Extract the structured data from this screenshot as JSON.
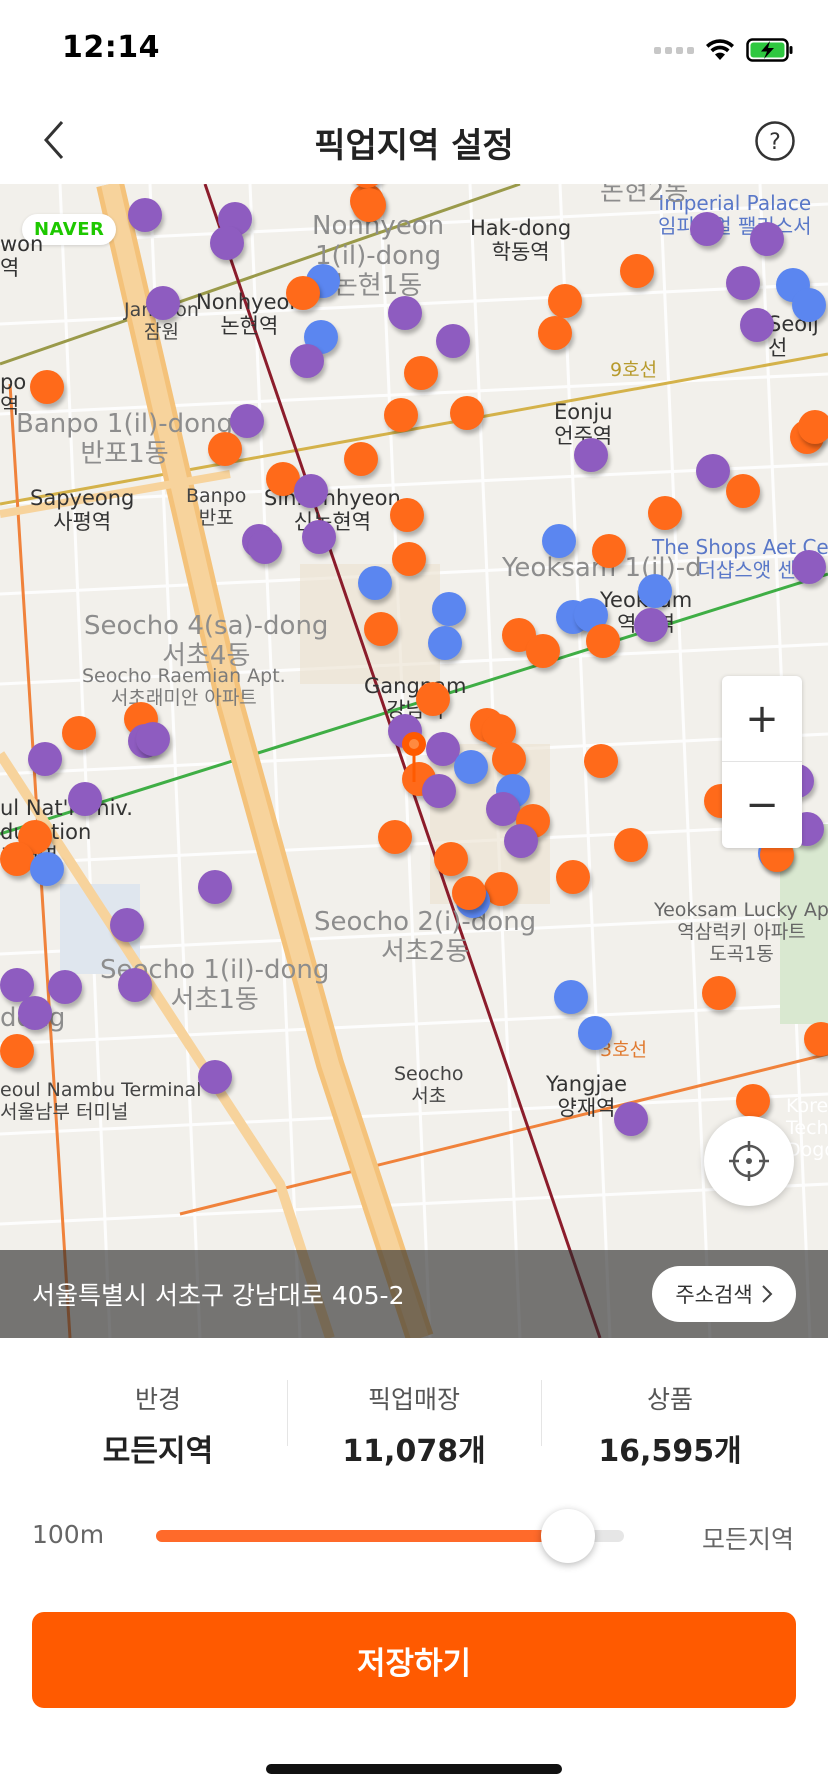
{
  "status_bar": {
    "time": "12:14"
  },
  "header": {
    "title": "픽업지역 설정"
  },
  "map": {
    "provider_logo": "NAVER",
    "labels": {
      "nonhyeon1": "Nonhyeon\n1(il)-dong\n논현1동",
      "hakdong": "Hak-dong\n학동역",
      "imperial": "Imperial Palace\n임피리얼 팰리스서",
      "jamwon": "Jamwon\n잠원",
      "nonhyeon_stn": "Nonhyeon\n논현역",
      "banpo1": "Banpo 1(il)-dong\n반포1동",
      "eonju": "Eonju\n언주역",
      "sapyeong": "Sapyeong\n사평역",
      "banpo_ic": "Banpo\n반포",
      "sinnonhyeon": "Sinnonhyeon\n신논현역",
      "shops": "The Shops Aet Cen\n더샵스앳 센",
      "yeoksam1": "Yeoksam 1(il)-d",
      "yeoksam_stn": "Yeoksam\n역삼역",
      "seocho4": "Seocho 4(sa)-dong\n서초4동",
      "raemian": "Seocho Raemian Apt.\n서초래미안 아파트",
      "gangnam": "Gangnam\n강남역",
      "edu": "ul Nat'l Univ.\nducation\n교대역",
      "lucky": "Yeoksam Lucky Ap\n역삼럭키 아파트\n도곡1동",
      "seocho2": "Seocho 2(i)-dong\n서초2동",
      "seocho1": "Seocho 1(il)-dong\n서초1동",
      "nambu": "eoul Nambu Terminal\n서울남부 터미널",
      "seocho_ic": "Seocho\n서초",
      "yangjae": "Yangjae\n양재역",
      "line9": "9호선",
      "line3": "3호선",
      "dong_left": "dong",
      "po_left": "po\n역",
      "won_left": "won\n역",
      "seol_right": "Seolj\n선",
      "nonhyeon2": "논현2동",
      "korea_right": "Korea\nTechr\nDogo"
    },
    "zoom_in": "+",
    "zoom_out": "−",
    "address": "서울특별시 서초구 강남대로 405-2",
    "address_search_label": "주소검색",
    "colors": {
      "store": "#ff6a1a",
      "product": "#8e5cc0",
      "other": "#5b86f0",
      "pin": "#ff5a00"
    }
  },
  "stats": [
    {
      "label": "반경",
      "value": "모든지역"
    },
    {
      "label": "픽업매장",
      "value": "11,078개"
    },
    {
      "label": "상품",
      "value": "16,595개"
    }
  ],
  "radius_slider": {
    "min_label": "100m",
    "max_label": "모든지역",
    "value_fraction": 0.88
  },
  "save_label": "저장하기",
  "accent_color": "#ff5a00"
}
